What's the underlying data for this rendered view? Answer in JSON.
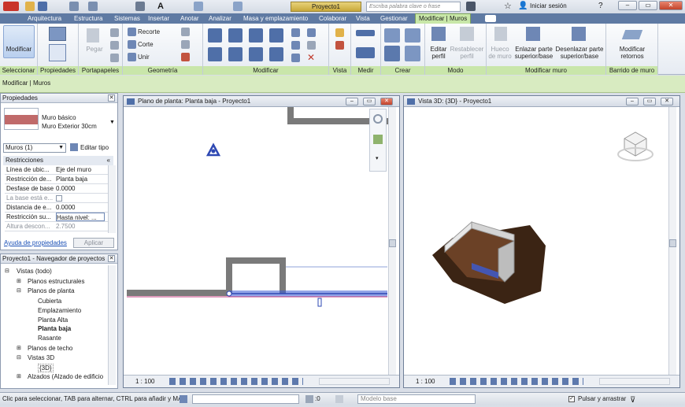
{
  "titlebar": {
    "project_title": "Proyecto1",
    "search_placeholder": "Escriba palabra clave o frase",
    "signin_label": "Iniciar sesión"
  },
  "ribbon_tabs": [
    {
      "label": "Arquitectura"
    },
    {
      "label": "Estructura"
    },
    {
      "label": "Sistemas"
    },
    {
      "label": "Insertar"
    },
    {
      "label": "Anotar"
    },
    {
      "label": "Analizar"
    },
    {
      "label": "Masa y emplazamiento"
    },
    {
      "label": "Colaborar"
    },
    {
      "label": "Vista"
    },
    {
      "label": "Gestionar"
    },
    {
      "label": "Modificar | Muros"
    }
  ],
  "ribbon": {
    "modify_button": "Modificar",
    "paste_button": "Pegar",
    "clipboard_items": [
      "Recorte",
      "Corte",
      "Unir"
    ],
    "edit_profile": "Editar perfil",
    "reset_profile": "Restablecer perfil",
    "wall_opening": "Hueco de muro",
    "attach_top_base": "Enlazar parte superior/base",
    "detach_top_base": "Desenlazar parte superior/base",
    "modify_returns": "Modificar retornos",
    "panels": [
      "Seleccionar",
      "Propiedades",
      "Portapapeles",
      "Geometría",
      "Modificar",
      "Vista",
      "Medir",
      "Crear",
      "Modo",
      "Modificar muro",
      "Barrido de muro"
    ]
  },
  "context_bar": "Modificar | Muros",
  "properties": {
    "header": "Propiedades",
    "type_family": "Muro básico",
    "type_name": "Muro Exterior 30cm",
    "selector": "Muros (1)",
    "edit_type": "Editar tipo",
    "group": "Restricciones",
    "rows": [
      {
        "name": "Línea de ubic...",
        "value": "Eje del muro"
      },
      {
        "name": "Restricción de...",
        "value": "Planta baja"
      },
      {
        "name": "Desfase de base",
        "value": "0.0000"
      },
      {
        "name": "La base está e...",
        "value": ""
      },
      {
        "name": "Distancia de e...",
        "value": "0.0000"
      },
      {
        "name": "Restricción su...",
        "value": "Hasta nivel: ..."
      },
      {
        "name": "Altura descon...",
        "value": "2.7500"
      }
    ],
    "help_link": "Ayuda de propiedades",
    "apply_button": "Aplicar"
  },
  "browser": {
    "header": "Proyecto1 - Navegador de proyectos",
    "items": [
      {
        "label": "Vistas (todo)",
        "bold": false
      },
      {
        "label": "Planos estructurales",
        "bold": false
      },
      {
        "label": "Planos de planta",
        "bold": false
      },
      {
        "label": "Cubierta",
        "bold": false
      },
      {
        "label": "Emplazamiento",
        "bold": false
      },
      {
        "label": "Planta Alta",
        "bold": false
      },
      {
        "label": "Planta baja",
        "bold": true
      },
      {
        "label": "Rasante",
        "bold": false
      },
      {
        "label": "Planos de techo",
        "bold": false
      },
      {
        "label": "Vistas 3D",
        "bold": false
      },
      {
        "label": "{3D}",
        "bold": false
      },
      {
        "label": "Alzados (Alzado de edificio",
        "bold": false
      }
    ]
  },
  "views": {
    "plan_title": "Plano de planta: Planta baja - Proyecto1",
    "view3d_title": "Vista 3D: {3D} - Proyecto1",
    "plan_scale": "1 : 100",
    "view3d_scale": "1 : 100"
  },
  "status": {
    "hint": "Clic para seleccionar, TAB para alternar, CTRL para añadir y MA",
    "zero": ":0",
    "model": "Modelo base",
    "press_drag": "Pulsar y arrastrar"
  },
  "colors": {
    "ribbon_tab_bar": "#5f7aa3",
    "context_green": "#d8ebc1",
    "selection_blue": "#3b5bd6"
  }
}
